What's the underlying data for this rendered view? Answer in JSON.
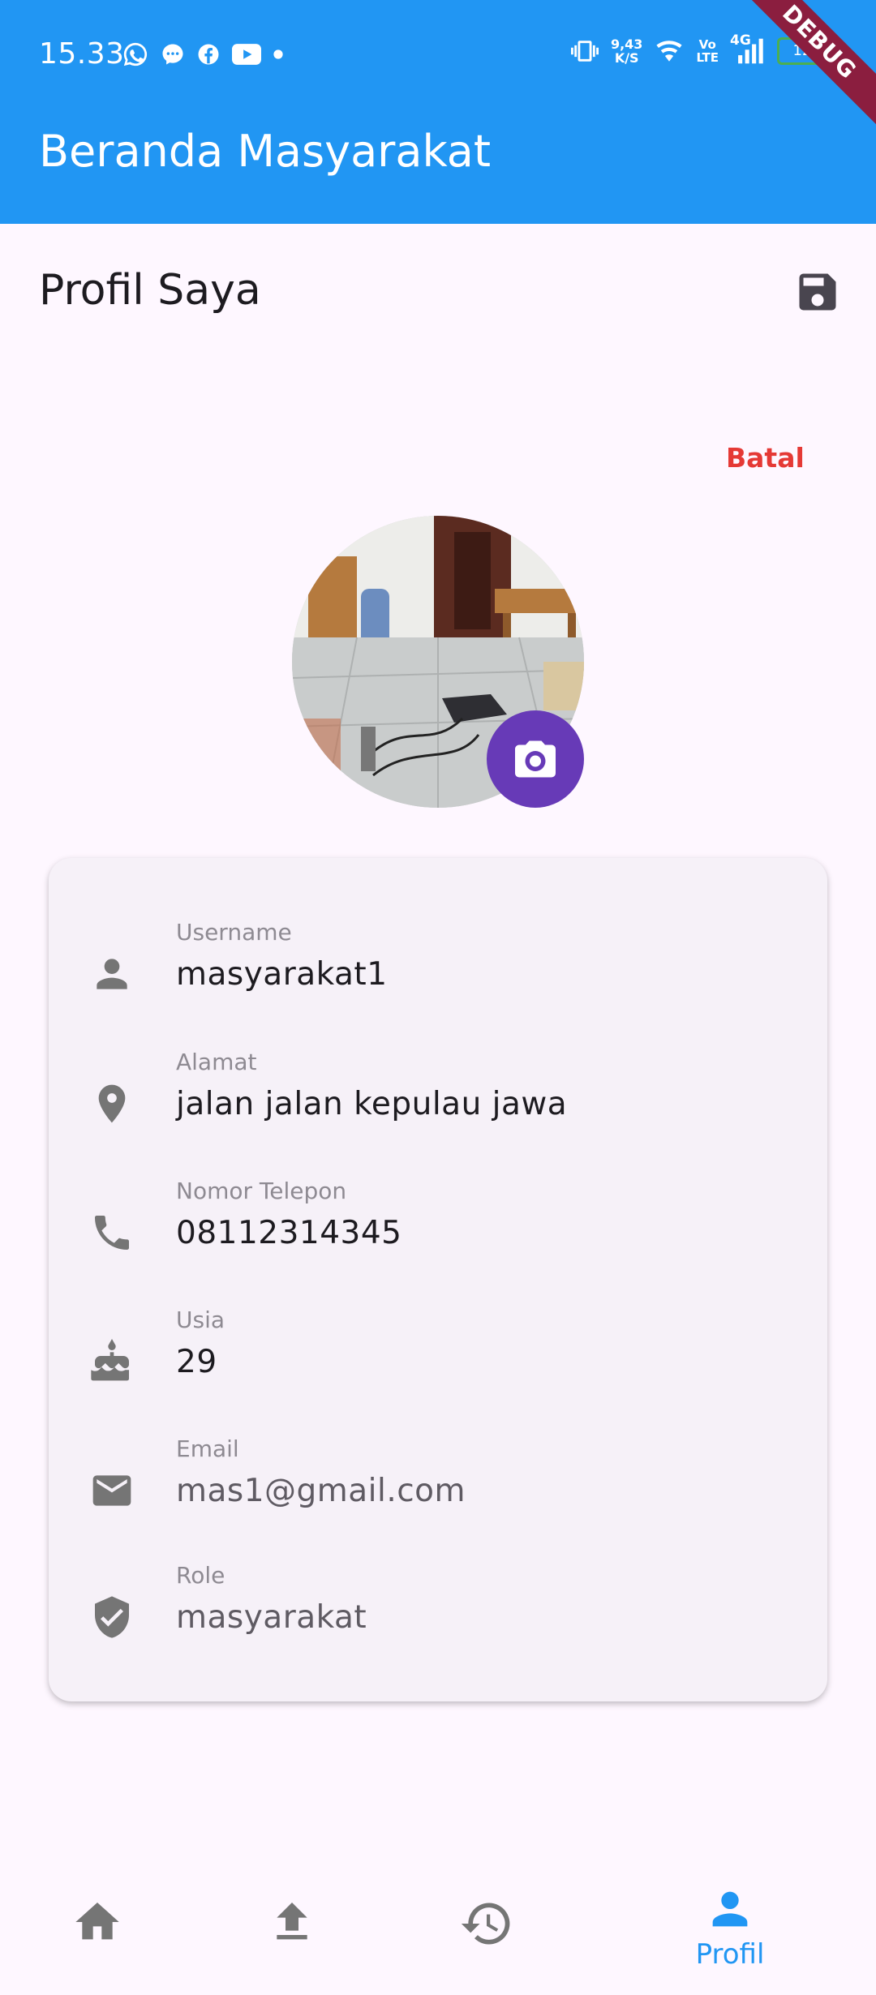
{
  "status_bar": {
    "time": "15.33",
    "net_speed_value": "9,43",
    "net_speed_unit": "K/S",
    "volte_top": "Vo",
    "volte_bottom": "LTE",
    "network": "4G",
    "battery": "12",
    "debug": "DEBUG",
    "left_icons": [
      "whatsapp-icon",
      "messenger-icon",
      "facebook-icon",
      "youtube-icon",
      "dot-icon"
    ],
    "right_icons": [
      "vibrate-icon",
      "wifi-icon",
      "signal-icon",
      "battery-icon"
    ]
  },
  "appbar": {
    "title": "Beranda Masyarakat",
    "color": "#2196F3"
  },
  "profile": {
    "title": "Profil Saya",
    "save_icon": "save-icon",
    "cancel_label": "Batal",
    "cancel_color": "#E53935",
    "camera_icon": "camera-icon",
    "camera_color": "#673AB7"
  },
  "fields": [
    {
      "icon": "person-icon",
      "label": "Username",
      "value": "masyarakat1"
    },
    {
      "icon": "location-icon",
      "label": "Alamat",
      "value": "jalan jalan kepulau jawa"
    },
    {
      "icon": "phone-icon",
      "label": "Nomor Telepon",
      "value": "08112314345"
    },
    {
      "icon": "cake-icon",
      "label": "Usia",
      "value": "29"
    },
    {
      "icon": "email-icon",
      "label": "Email",
      "value": "mas1@gmail.com"
    },
    {
      "icon": "shield-check-icon",
      "label": "Role",
      "value": "masyarakat"
    }
  ],
  "bottom_nav": {
    "items": [
      {
        "icon": "home-icon",
        "label": ""
      },
      {
        "icon": "upload-icon",
        "label": ""
      },
      {
        "icon": "history-icon",
        "label": ""
      },
      {
        "icon": "person-icon",
        "label": "Profil",
        "active": true
      }
    ],
    "active_color": "#2196F3"
  }
}
